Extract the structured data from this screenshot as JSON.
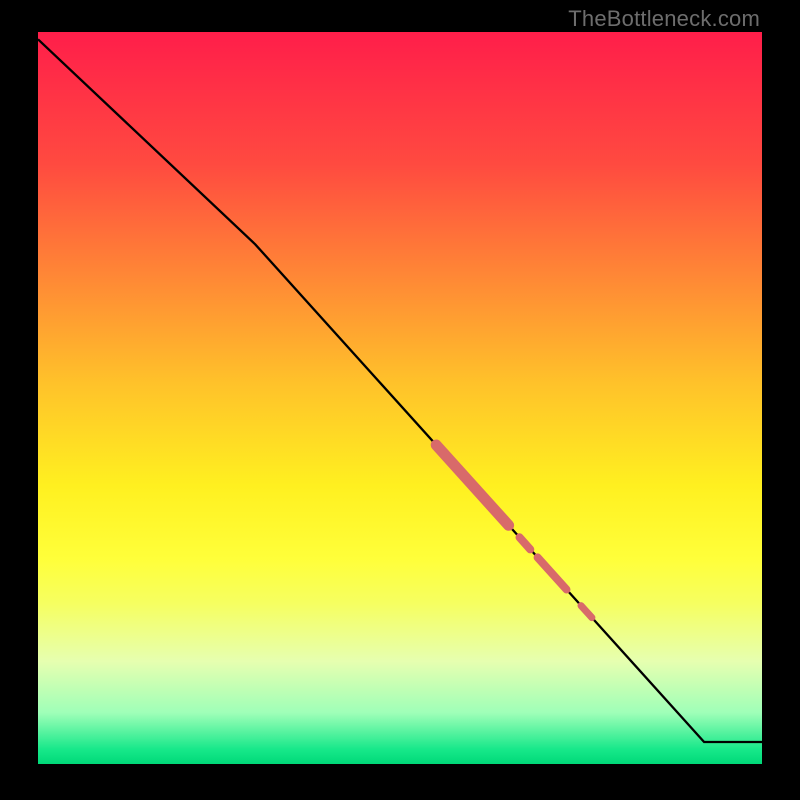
{
  "watermark": "TheBottleneck.com",
  "colors": {
    "curve": "#000000",
    "highlight": "#d86a6a",
    "background_frame": "#000000"
  },
  "chart_data": {
    "type": "line",
    "title": "",
    "xlabel": "",
    "ylabel": "",
    "xlim": [
      0,
      100
    ],
    "ylim": [
      0,
      100
    ],
    "grid": false,
    "legend": false,
    "series": [
      {
        "name": "curve",
        "x": [
          0,
          30,
          92,
          100
        ],
        "y": [
          99,
          71,
          3,
          3
        ]
      }
    ],
    "highlight_segments": [
      {
        "x_start": 55,
        "x_end": 65,
        "width": 11
      },
      {
        "x_start": 66.5,
        "x_end": 68,
        "width": 8
      },
      {
        "x_start": 69,
        "x_end": 73,
        "width": 8
      },
      {
        "x_start": 75,
        "x_end": 76.5,
        "width": 7
      }
    ],
    "gradient_stops": [
      {
        "pct": 0,
        "color": "#ff1e4a"
      },
      {
        "pct": 18,
        "color": "#ff4a40"
      },
      {
        "pct": 34,
        "color": "#ff8a35"
      },
      {
        "pct": 48,
        "color": "#ffc22a"
      },
      {
        "pct": 62,
        "color": "#fff020"
      },
      {
        "pct": 72,
        "color": "#ffff3a"
      },
      {
        "pct": 78,
        "color": "#f6ff60"
      },
      {
        "pct": 86,
        "color": "#e6ffb0"
      },
      {
        "pct": 93,
        "color": "#9fffb8"
      },
      {
        "pct": 98,
        "color": "#17e88a"
      },
      {
        "pct": 100,
        "color": "#00d978"
      }
    ]
  }
}
